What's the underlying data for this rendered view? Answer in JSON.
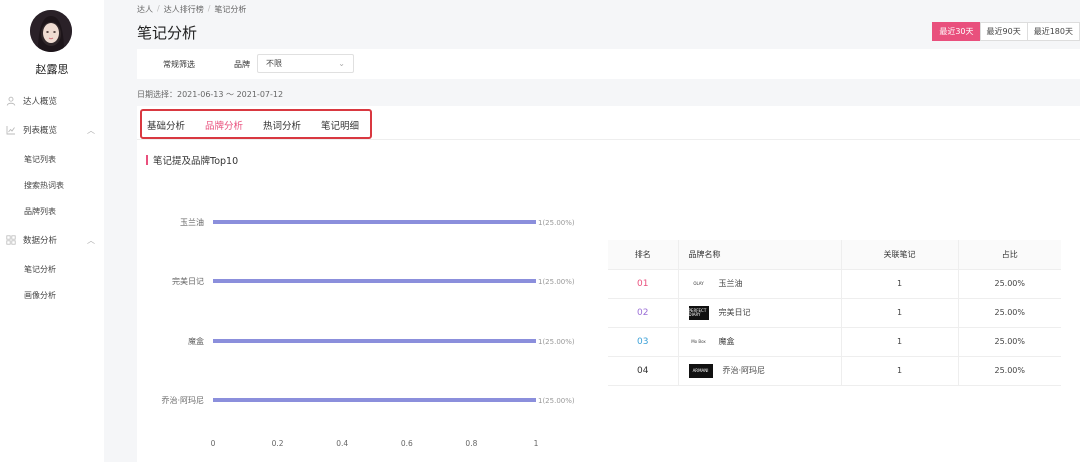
{
  "user": {
    "name": "赵露思"
  },
  "sidebar": {
    "items": [
      {
        "label": "达人概览",
        "icon": "user-icon"
      },
      {
        "label": "列表概览",
        "icon": "chart-icon",
        "chevron": "︿"
      },
      {
        "label": "数据分析",
        "icon": "grid-icon",
        "chevron": "︿"
      }
    ],
    "list_sub": [
      "笔记列表",
      "搜索热词表",
      "品牌列表"
    ],
    "analysis_sub": [
      "笔记分析",
      "画像分析"
    ]
  },
  "breadcrumb": [
    "达人",
    "达人排行榜",
    "笔记分析"
  ],
  "breadcrumb_sep": "/",
  "page": {
    "title": "笔记分析"
  },
  "range_buttons": [
    {
      "label": "最近30天",
      "active": true
    },
    {
      "label": "最近90天",
      "active": false
    },
    {
      "label": "最近180天",
      "active": false
    }
  ],
  "filter": {
    "label": "常规筛选",
    "brand_label": "品牌",
    "brand_value": "不限"
  },
  "date_range": "日期选择：2021-06-13 ～ 2021-07-12",
  "tabs": [
    {
      "label": "基础分析",
      "active": false
    },
    {
      "label": "品牌分析",
      "active": true
    },
    {
      "label": "热词分析",
      "active": false
    },
    {
      "label": "笔记明细",
      "active": false
    }
  ],
  "section_title": "笔记提及品牌Top10",
  "chart_data": {
    "type": "bar",
    "orientation": "horizontal",
    "categories": [
      "玉兰油",
      "完美日记",
      "魔盒",
      "乔治·阿玛尼"
    ],
    "values": [
      1,
      1,
      1,
      1
    ],
    "data_labels": [
      "1(25.00%)",
      "1(25.00%)",
      "1(25.00%)",
      "1(25.00%)"
    ],
    "xticks": [
      "0",
      "0.2",
      "0.4",
      "0.6",
      "0.8",
      "1"
    ],
    "xlim": [
      0,
      1
    ],
    "bar_color": "#8b8fdc",
    "title": "",
    "xlabel": "",
    "ylabel": ""
  },
  "table": {
    "headers": [
      "排名",
      "品牌名称",
      "关联笔记",
      "占比"
    ],
    "rows": [
      {
        "rank": "01",
        "rank_color": "#e9507d",
        "name": "玉兰油",
        "logo": "olay-logo-icon",
        "logo_text": "OLAY",
        "notes": "1",
        "ratio": "25.00%"
      },
      {
        "rank": "02",
        "rank_color": "#9b6fd6",
        "name": "完美日记",
        "logo": "perfect-diary-logo-icon",
        "logo_text": "PERFECT DIARY",
        "notes": "1",
        "ratio": "25.00%"
      },
      {
        "rank": "03",
        "rank_color": "#3aa0d8",
        "name": "魔盒",
        "logo": "mo-box-logo-icon",
        "logo_text": "Mo Box",
        "notes": "1",
        "ratio": "25.00%"
      },
      {
        "rank": "04",
        "rank_color": "#333333",
        "name": "乔治·阿玛尼",
        "logo": "armani-logo-icon",
        "logo_text": "ARMANI",
        "notes": "1",
        "ratio": "25.00%"
      }
    ]
  }
}
